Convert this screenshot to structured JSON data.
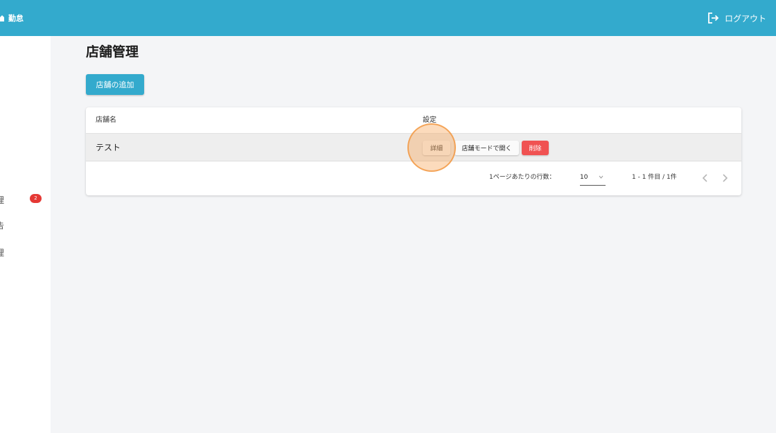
{
  "header": {
    "brand_text": "勤怠",
    "logout_label": "ログアウト"
  },
  "sidebar": {
    "items": [
      {
        "fragment": "理",
        "badge": "2"
      },
      {
        "fragment": "告"
      },
      {
        "fragment": "理"
      }
    ]
  },
  "page": {
    "title": "店舗管理",
    "add_button_label": "店舗の追加"
  },
  "table": {
    "columns": [
      "店舗名",
      "設定"
    ],
    "rows": [
      {
        "name": "テスト",
        "actions": {
          "detail_label": "詳細",
          "open_label": "店舗モードで開く",
          "delete_label": "削除"
        }
      }
    ]
  },
  "pagination": {
    "rows_per_page_label": "1ページあたりの行数：",
    "rows_per_page_value": "10",
    "range_text": "1 - 1 件目 / 1件"
  },
  "colors": {
    "primary": "#33aacd",
    "danger": "#f05252",
    "badge": "#e53935",
    "click_marker": "#f8a050"
  },
  "icons": [
    "home-icon",
    "logout-icon",
    "chevron-down-icon",
    "chevron-left-icon",
    "chevron-right-icon"
  ]
}
